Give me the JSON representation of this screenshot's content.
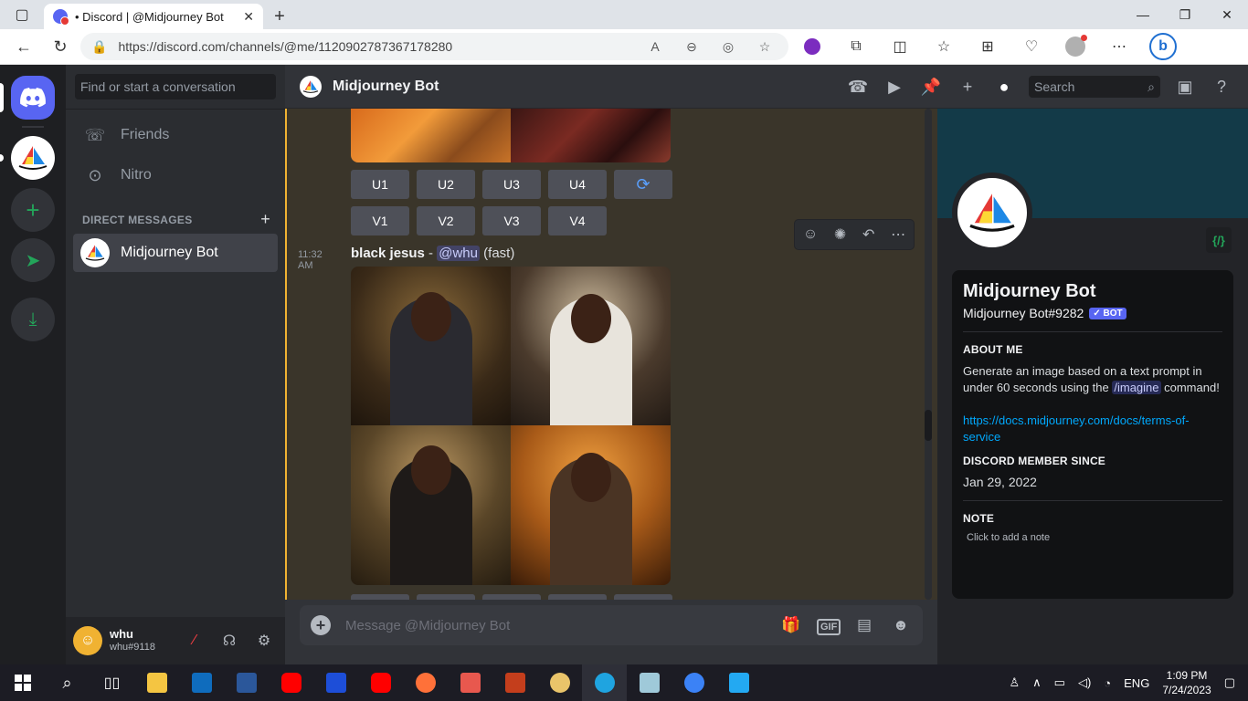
{
  "browser": {
    "tab_title": "• Discord | @Midjourney Bot",
    "url": "https://discord.com/channels/@me/1120902787367178280"
  },
  "dm_sidebar": {
    "search_placeholder": "Find or start a conversation",
    "nav": [
      {
        "label": "Friends",
        "icon": "friends-icon"
      },
      {
        "label": "Nitro",
        "icon": "nitro-icon"
      }
    ],
    "section_header": "DIRECT MESSAGES",
    "dms": [
      {
        "label": "Midjourney Bot"
      }
    ]
  },
  "user_panel": {
    "name": "whu",
    "tag": "whu#9118"
  },
  "channel_header": {
    "title": "Midjourney Bot",
    "search_placeholder": "Search"
  },
  "messages": {
    "upscale_buttons": [
      "U1",
      "U2",
      "U3",
      "U4"
    ],
    "variation_buttons": [
      "V1",
      "V2",
      "V3",
      "V4"
    ],
    "reroll_icon": "⟳",
    "latest": {
      "time": "11:32 AM",
      "prompt": "black jesus",
      "separator": " - ",
      "mention": "@whu",
      "mode": "(fast)"
    }
  },
  "composer": {
    "placeholder": "Message @Midjourney Bot"
  },
  "profile": {
    "name": "Midjourney Bot",
    "tag": "Midjourney Bot#9282",
    "bot_badge": "✓ BOT",
    "about_heading": "ABOUT ME",
    "about_text_1": "Generate an image based on a text prompt in under 60 seconds using the",
    "about_cmd": "/imagine",
    "about_text_2": "command!",
    "link": "https://docs.midjourney.com/docs/terms-of-service",
    "member_since_heading": "DISCORD MEMBER SINCE",
    "member_since": "Jan 29, 2022",
    "note_heading": "NOTE",
    "note_placeholder": "Click to add a note",
    "badge_icon": "{/}"
  },
  "taskbar": {
    "language": "ENG",
    "time": "1:09 PM",
    "date": "7/24/2023"
  },
  "colors": {
    "blurple": "#5865f2",
    "green": "#23a55a",
    "highlight_bar": "#f0b232",
    "link": "#00a8fc"
  }
}
